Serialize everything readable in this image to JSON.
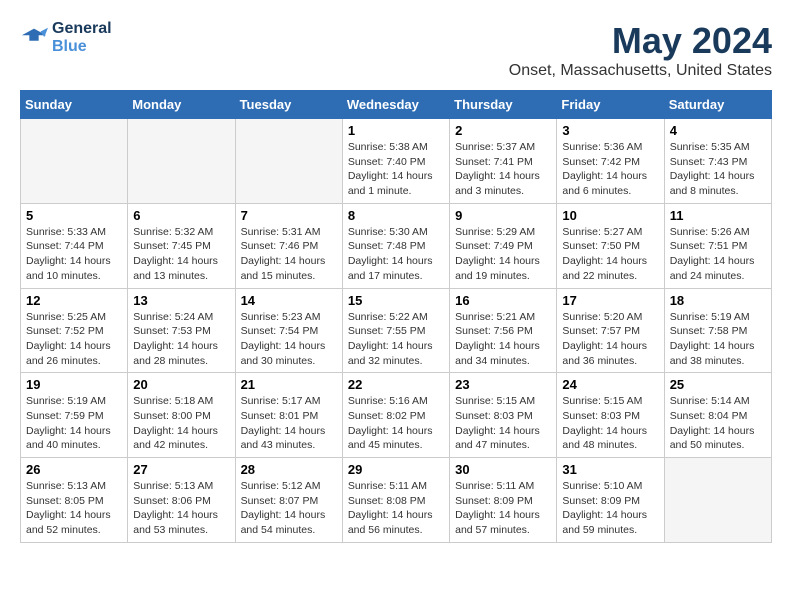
{
  "logo": {
    "line1": "General",
    "line2": "Blue"
  },
  "title": "May 2024",
  "subtitle": "Onset, Massachusetts, United States",
  "weekdays": [
    "Sunday",
    "Monday",
    "Tuesday",
    "Wednesday",
    "Thursday",
    "Friday",
    "Saturday"
  ],
  "weeks": [
    [
      {
        "day": "",
        "empty": true
      },
      {
        "day": "",
        "empty": true
      },
      {
        "day": "",
        "empty": true
      },
      {
        "day": "1",
        "sunrise": "5:38 AM",
        "sunset": "7:40 PM",
        "daylight": "14 hours and 1 minute."
      },
      {
        "day": "2",
        "sunrise": "5:37 AM",
        "sunset": "7:41 PM",
        "daylight": "14 hours and 3 minutes."
      },
      {
        "day": "3",
        "sunrise": "5:36 AM",
        "sunset": "7:42 PM",
        "daylight": "14 hours and 6 minutes."
      },
      {
        "day": "4",
        "sunrise": "5:35 AM",
        "sunset": "7:43 PM",
        "daylight": "14 hours and 8 minutes."
      }
    ],
    [
      {
        "day": "5",
        "sunrise": "5:33 AM",
        "sunset": "7:44 PM",
        "daylight": "14 hours and 10 minutes."
      },
      {
        "day": "6",
        "sunrise": "5:32 AM",
        "sunset": "7:45 PM",
        "daylight": "14 hours and 13 minutes."
      },
      {
        "day": "7",
        "sunrise": "5:31 AM",
        "sunset": "7:46 PM",
        "daylight": "14 hours and 15 minutes."
      },
      {
        "day": "8",
        "sunrise": "5:30 AM",
        "sunset": "7:48 PM",
        "daylight": "14 hours and 17 minutes."
      },
      {
        "day": "9",
        "sunrise": "5:29 AM",
        "sunset": "7:49 PM",
        "daylight": "14 hours and 19 minutes."
      },
      {
        "day": "10",
        "sunrise": "5:27 AM",
        "sunset": "7:50 PM",
        "daylight": "14 hours and 22 minutes."
      },
      {
        "day": "11",
        "sunrise": "5:26 AM",
        "sunset": "7:51 PM",
        "daylight": "14 hours and 24 minutes."
      }
    ],
    [
      {
        "day": "12",
        "sunrise": "5:25 AM",
        "sunset": "7:52 PM",
        "daylight": "14 hours and 26 minutes."
      },
      {
        "day": "13",
        "sunrise": "5:24 AM",
        "sunset": "7:53 PM",
        "daylight": "14 hours and 28 minutes."
      },
      {
        "day": "14",
        "sunrise": "5:23 AM",
        "sunset": "7:54 PM",
        "daylight": "14 hours and 30 minutes."
      },
      {
        "day": "15",
        "sunrise": "5:22 AM",
        "sunset": "7:55 PM",
        "daylight": "14 hours and 32 minutes."
      },
      {
        "day": "16",
        "sunrise": "5:21 AM",
        "sunset": "7:56 PM",
        "daylight": "14 hours and 34 minutes."
      },
      {
        "day": "17",
        "sunrise": "5:20 AM",
        "sunset": "7:57 PM",
        "daylight": "14 hours and 36 minutes."
      },
      {
        "day": "18",
        "sunrise": "5:19 AM",
        "sunset": "7:58 PM",
        "daylight": "14 hours and 38 minutes."
      }
    ],
    [
      {
        "day": "19",
        "sunrise": "5:19 AM",
        "sunset": "7:59 PM",
        "daylight": "14 hours and 40 minutes."
      },
      {
        "day": "20",
        "sunrise": "5:18 AM",
        "sunset": "8:00 PM",
        "daylight": "14 hours and 42 minutes."
      },
      {
        "day": "21",
        "sunrise": "5:17 AM",
        "sunset": "8:01 PM",
        "daylight": "14 hours and 43 minutes."
      },
      {
        "day": "22",
        "sunrise": "5:16 AM",
        "sunset": "8:02 PM",
        "daylight": "14 hours and 45 minutes."
      },
      {
        "day": "23",
        "sunrise": "5:15 AM",
        "sunset": "8:03 PM",
        "daylight": "14 hours and 47 minutes."
      },
      {
        "day": "24",
        "sunrise": "5:15 AM",
        "sunset": "8:03 PM",
        "daylight": "14 hours and 48 minutes."
      },
      {
        "day": "25",
        "sunrise": "5:14 AM",
        "sunset": "8:04 PM",
        "daylight": "14 hours and 50 minutes."
      }
    ],
    [
      {
        "day": "26",
        "sunrise": "5:13 AM",
        "sunset": "8:05 PM",
        "daylight": "14 hours and 52 minutes."
      },
      {
        "day": "27",
        "sunrise": "5:13 AM",
        "sunset": "8:06 PM",
        "daylight": "14 hours and 53 minutes."
      },
      {
        "day": "28",
        "sunrise": "5:12 AM",
        "sunset": "8:07 PM",
        "daylight": "14 hours and 54 minutes."
      },
      {
        "day": "29",
        "sunrise": "5:11 AM",
        "sunset": "8:08 PM",
        "daylight": "14 hours and 56 minutes."
      },
      {
        "day": "30",
        "sunrise": "5:11 AM",
        "sunset": "8:09 PM",
        "daylight": "14 hours and 57 minutes."
      },
      {
        "day": "31",
        "sunrise": "5:10 AM",
        "sunset": "8:09 PM",
        "daylight": "14 hours and 59 minutes."
      },
      {
        "day": "",
        "empty": true
      }
    ]
  ],
  "labels": {
    "sunrise": "Sunrise:",
    "sunset": "Sunset:",
    "daylight": "Daylight:"
  }
}
